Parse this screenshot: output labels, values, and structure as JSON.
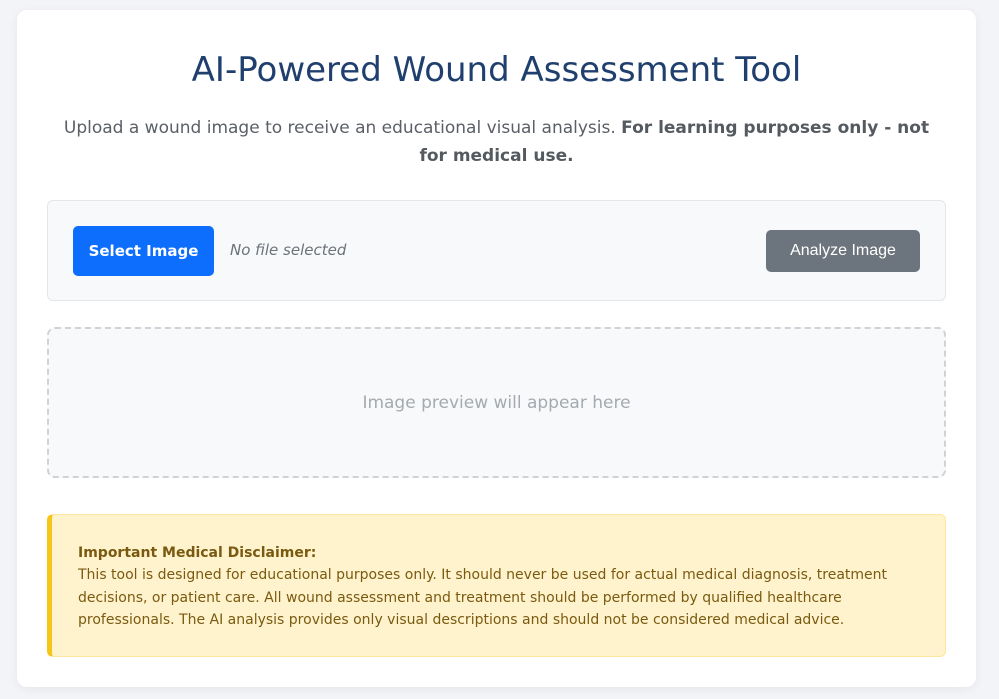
{
  "header": {
    "title": "AI-Powered Wound Assessment Tool",
    "subtitle_text": "Upload a wound image to receive an educational visual analysis. ",
    "subtitle_bold": "For learning purposes only - not for medical use."
  },
  "upload": {
    "select_label": "Select Image",
    "file_status": "No file selected",
    "analyze_label": "Analyze Image"
  },
  "preview": {
    "placeholder": "Image preview will appear here"
  },
  "disclaimer": {
    "title": "Important Medical Disclaimer:",
    "body": "This tool is designed for educational purposes only. It should never be used for actual medical diagnosis, treatment decisions, or patient care. All wound assessment and treatment should be performed by qualified healthcare professionals. The AI analysis provides only visual descriptions and should not be considered medical advice."
  },
  "colors": {
    "title": "#1f3f6e",
    "primary_button": "#0d6efd",
    "secondary_button": "#6c757d",
    "warning_background": "#fff3cd",
    "warning_accent": "#f5c518"
  }
}
